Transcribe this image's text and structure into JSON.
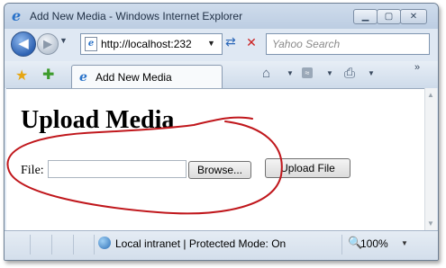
{
  "window": {
    "title": "Add New Media - Windows Internet Explorer",
    "minimize_symbol": "▁",
    "maximize_symbol": "▢",
    "close_symbol": "✕"
  },
  "navbar": {
    "address": "http://localhost:232",
    "search_placeholder": "Yahoo Search"
  },
  "tabbar": {
    "tab_label": "Add New Media",
    "chevron": "»"
  },
  "page": {
    "heading": "Upload Media",
    "file_label": "File:",
    "browse_label": "Browse...",
    "upload_label": "Upload File"
  },
  "statusbar": {
    "zone_text": "Local intranet | Protected Mode: On",
    "zoom": "100%"
  },
  "icons": [
    "ie-logo-icon",
    "back-arrow-icon",
    "forward-arrow-icon",
    "page-icon",
    "refresh-icon",
    "stop-icon",
    "favorites-star-icon",
    "add-favorite-icon",
    "home-icon",
    "feeds-icon",
    "print-icon",
    "globe-icon",
    "zoom-icon"
  ],
  "colors": {
    "annotation_stroke": "#c0171c",
    "titlebar": "#c6d5e8",
    "page_bg": "#ffffff"
  }
}
